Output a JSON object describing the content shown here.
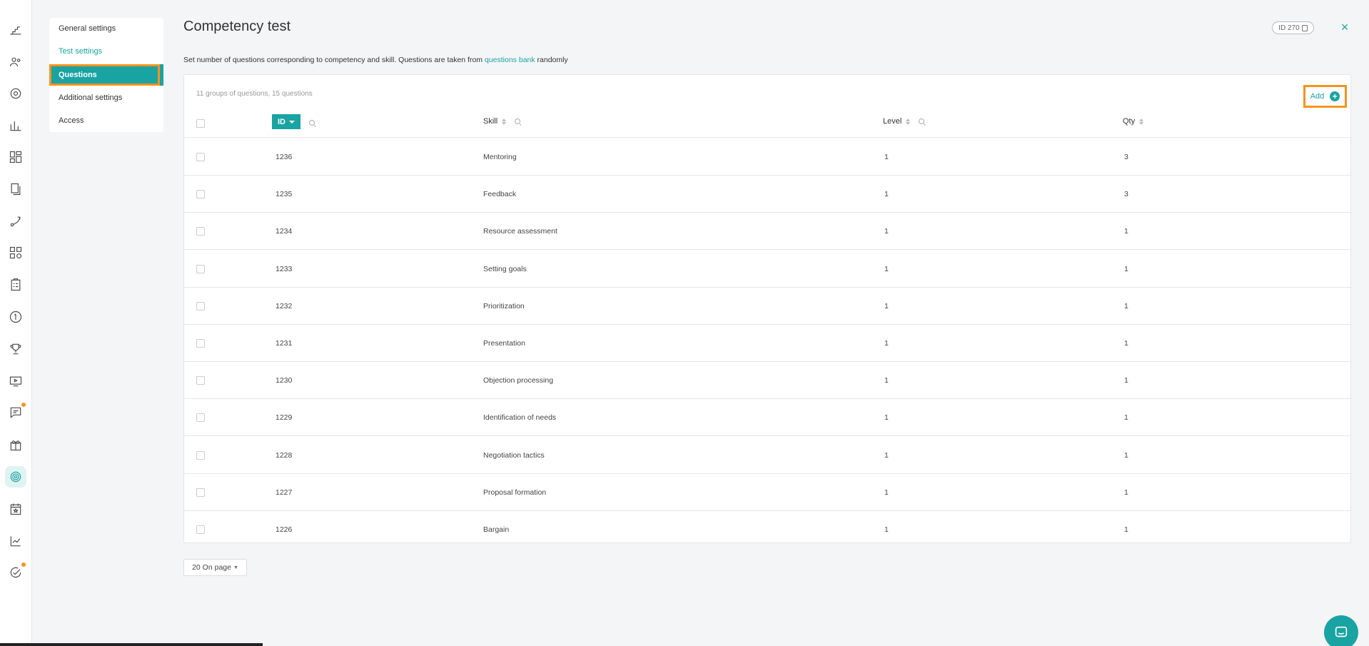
{
  "rail": {
    "items": [
      {
        "name": "rail-stairs-icon",
        "dot": false,
        "active": false
      },
      {
        "name": "rail-people-icon",
        "dot": false,
        "active": false
      },
      {
        "name": "rail-gear-icon",
        "dot": false,
        "active": false
      },
      {
        "name": "rail-bar-chart-icon",
        "dot": false,
        "active": false
      },
      {
        "name": "rail-dashboard-icon",
        "dot": false,
        "active": false
      },
      {
        "name": "rail-documents-icon",
        "dot": false,
        "active": false
      },
      {
        "name": "rail-route-icon",
        "dot": false,
        "active": false
      },
      {
        "name": "rail-apps-icon",
        "dot": false,
        "active": false
      },
      {
        "name": "rail-checklist-icon",
        "dot": false,
        "active": false
      },
      {
        "name": "rail-number-one-icon",
        "dot": false,
        "active": false
      },
      {
        "name": "rail-trophy-icon",
        "dot": false,
        "active": false
      },
      {
        "name": "rail-video-icon",
        "dot": false,
        "active": false
      },
      {
        "name": "rail-chat-icon",
        "dot": true,
        "active": false
      },
      {
        "name": "rail-gift-icon",
        "dot": false,
        "active": false
      },
      {
        "name": "rail-target-icon",
        "dot": false,
        "active": true
      },
      {
        "name": "rail-calendar-icon",
        "dot": false,
        "active": false
      },
      {
        "name": "rail-trend-icon",
        "dot": false,
        "active": false
      },
      {
        "name": "rail-check-circle-icon",
        "dot": true,
        "active": false
      }
    ]
  },
  "settings_nav": {
    "items": [
      "General settings",
      "Test settings",
      "Questions",
      "Additional settings",
      "Access"
    ]
  },
  "header": {
    "title": "Competency test",
    "id_badge": "ID 270",
    "close": "×"
  },
  "description": {
    "before": "Set number of questions corresponding to competency and skill. Questions are taken from ",
    "link": "questions bank",
    "after": " randomly"
  },
  "table": {
    "count_text": "11 groups of questions, 15 questions",
    "add_label": "Add",
    "columns": [
      "ID",
      "Skill",
      "Level",
      "Qty"
    ],
    "rows": [
      {
        "id": "1236",
        "skill": "Mentoring",
        "level": "1",
        "qty": "3"
      },
      {
        "id": "1235",
        "skill": "Feedback",
        "level": "1",
        "qty": "3"
      },
      {
        "id": "1234",
        "skill": "Resource assessment",
        "level": "1",
        "qty": "1"
      },
      {
        "id": "1233",
        "skill": "Setting goals",
        "level": "1",
        "qty": "1"
      },
      {
        "id": "1232",
        "skill": "Prioritization",
        "level": "1",
        "qty": "1"
      },
      {
        "id": "1231",
        "skill": "Presentation",
        "level": "1",
        "qty": "1"
      },
      {
        "id": "1230",
        "skill": "Objection processing",
        "level": "1",
        "qty": "1"
      },
      {
        "id": "1229",
        "skill": "Identification of needs",
        "level": "1",
        "qty": "1"
      },
      {
        "id": "1228",
        "skill": "Negotiation tactics",
        "level": "1",
        "qty": "1"
      },
      {
        "id": "1227",
        "skill": "Proposal formation",
        "level": "1",
        "qty": "1"
      },
      {
        "id": "1226",
        "skill": "Bargain",
        "level": "1",
        "qty": "1"
      }
    ]
  },
  "pager": {
    "label": "20 On page"
  },
  "colors": {
    "accent": "#1aa3a3",
    "highlight": "#f7931e"
  }
}
